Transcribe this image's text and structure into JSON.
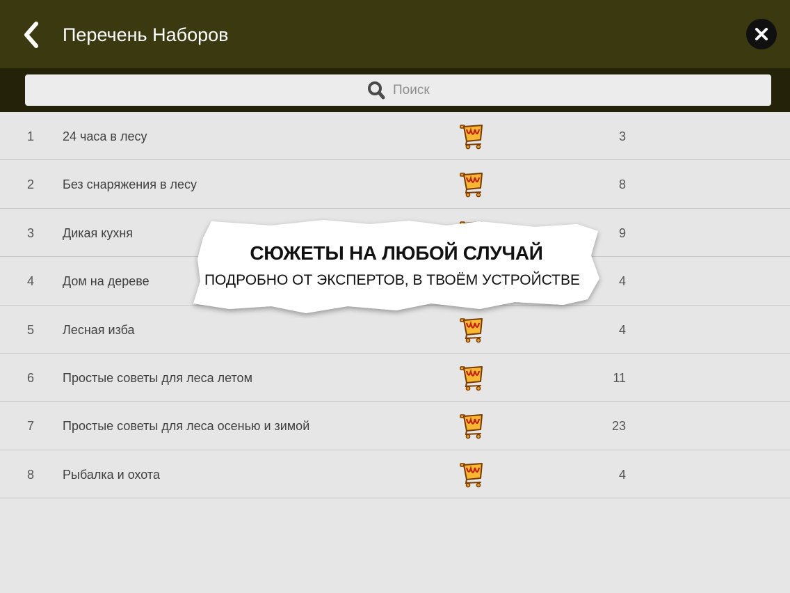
{
  "header": {
    "title": "Перечень Наборов",
    "back_icon": "chevron-left-icon",
    "close_icon": "close-icon"
  },
  "search": {
    "placeholder": "Поиск",
    "icon": "search-icon"
  },
  "list": {
    "rows": [
      {
        "number": "1",
        "name": "24 часа в лесу",
        "count": "3"
      },
      {
        "number": "2",
        "name": "Без снаряжения в лесу",
        "count": "8"
      },
      {
        "number": "3",
        "name": "Дикая кухня",
        "count": "9"
      },
      {
        "number": "4",
        "name": "Дом на дереве",
        "count": "4"
      },
      {
        "number": "5",
        "name": "Лесная изба",
        "count": "4"
      },
      {
        "number": "6",
        "name": "Простые советы для леса летом",
        "count": "11"
      },
      {
        "number": "7",
        "name": "Простые советы для леса осенью и зимой",
        "count": "23"
      },
      {
        "number": "8",
        "name": "Рыбалка и охота",
        "count": "4"
      }
    ],
    "row_icon": "shopping-cart-icon"
  },
  "promo": {
    "title": "СЮЖЕТЫ НА ЛЮБОЙ СЛУЧАЙ",
    "subtitle": "ПОДРОБНО ОТ ЭКСПЕРТОВ, В ТВОЁМ УСТРОЙСТВЕ"
  },
  "colors": {
    "header_bg": "#3b3910",
    "search_bar_bg": "#24230a",
    "list_bg": "#e7e6e6",
    "cart_orange": "#f0a21e"
  }
}
